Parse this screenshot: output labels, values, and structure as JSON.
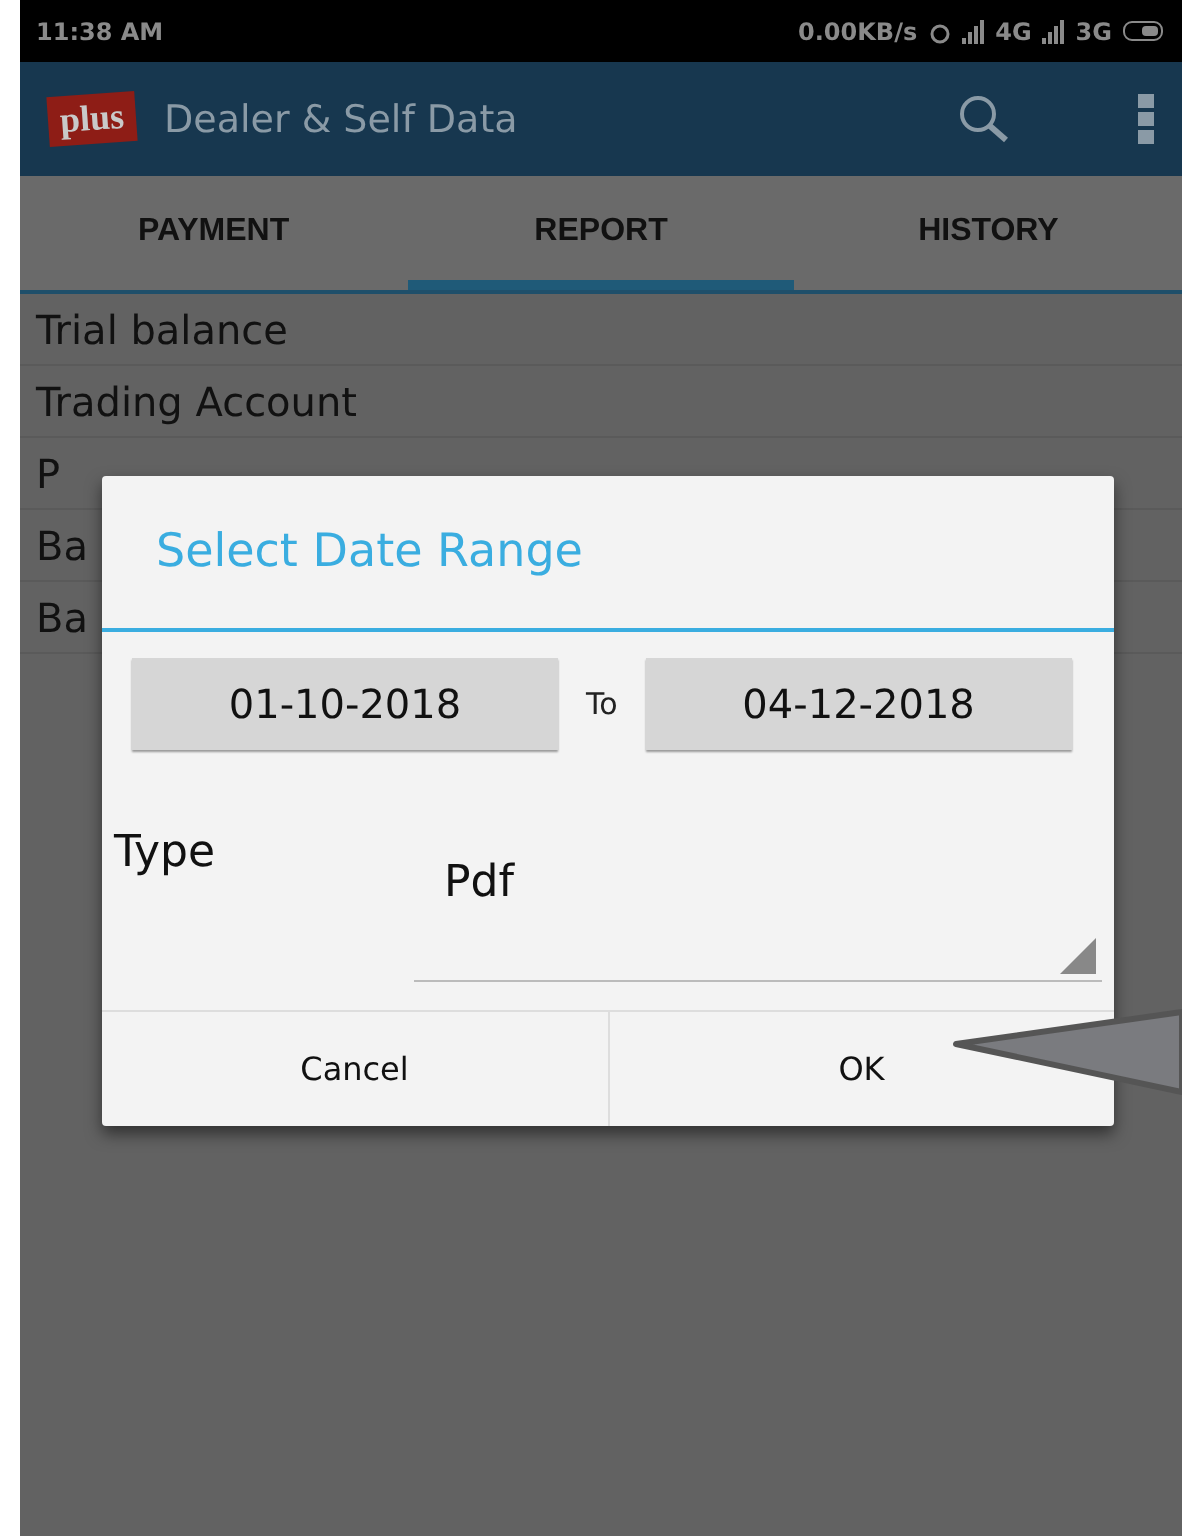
{
  "status_bar": {
    "time": "11:38 AM",
    "speed": "0.00KB/s",
    "network_1": "4G",
    "network_2": "3G"
  },
  "app_bar": {
    "logo": "plus",
    "title": "Dealer & Self Data"
  },
  "tabs": [
    {
      "label": "PAYMENT",
      "selected": false
    },
    {
      "label": "REPORT",
      "selected": true
    },
    {
      "label": "HISTORY",
      "selected": false
    }
  ],
  "list": [
    "Trial balance",
    "Trading Account",
    "P",
    "Ba",
    "Ba"
  ],
  "dialog": {
    "title": "Select Date Range",
    "from_date": "01-10-2018",
    "separator": "To",
    "to_date": "04-12-2018",
    "type_label": "Type",
    "type_value": "Pdf",
    "buttons": [
      "Cancel",
      "OK"
    ]
  }
}
